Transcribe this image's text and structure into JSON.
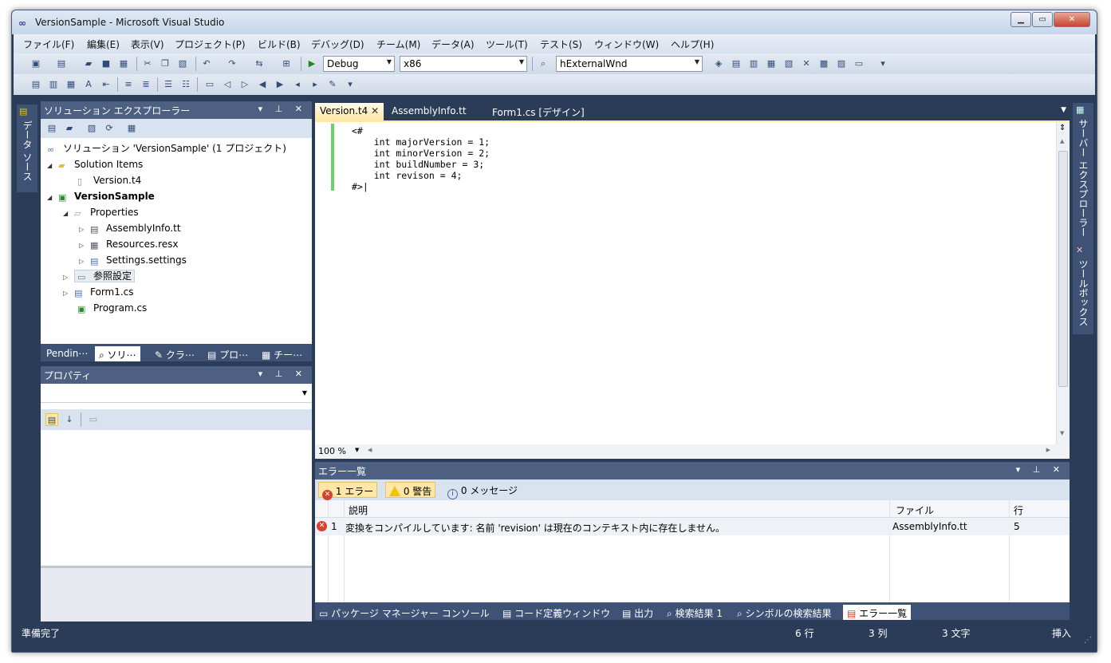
{
  "window": {
    "title": "VersionSample - Microsoft Visual Studio"
  },
  "menu": [
    "ファイル(F)",
    "編集(E)",
    "表示(V)",
    "プロジェクト(P)",
    "ビルド(B)",
    "デバッグ(D)",
    "チーム(M)",
    "データ(A)",
    "ツール(T)",
    "テスト(S)",
    "ウィンドウ(W)",
    "ヘルプ(H)"
  ],
  "toolbar": {
    "config": "Debug",
    "platform": "x86",
    "find": "hExternalWnd"
  },
  "left_side_tab": "データ ソース",
  "right_side_tabs": [
    "サーバー エクスプローラー",
    "ツールボックス"
  ],
  "solution_explorer": {
    "title": "ソリューション エクスプローラー",
    "tree": [
      {
        "label": "ソリューション 'VersionSample' (1 プロジェクト)"
      },
      {
        "label": "Solution Items"
      },
      {
        "label": "Version.t4"
      },
      {
        "label": "VersionSample"
      },
      {
        "label": "Properties"
      },
      {
        "label": "AssemblyInfo.tt"
      },
      {
        "label": "Resources.resx"
      },
      {
        "label": "Settings.settings"
      },
      {
        "label": "参照設定"
      },
      {
        "label": "Form1.cs"
      },
      {
        "label": "Program.cs"
      }
    ],
    "tabs": [
      "Pendin⋯",
      "ソリ⋯",
      "クラ⋯",
      "プロ⋯",
      "チー⋯"
    ]
  },
  "properties": {
    "title": "プロパティ"
  },
  "editor": {
    "tabs": [
      "Version.t4",
      "AssemblyInfo.tt",
      "Form1.cs [デザイン]"
    ],
    "code": "<#\n    int majorVersion = 1;\n    int minorVersion = 2;\n    int buildNumber = 3;\n    int revison = 4;\n#>|",
    "zoom": "100 %"
  },
  "error_list": {
    "title": "エラー一覧",
    "errors_btn": "1 エラー",
    "warnings_btn": "0 警告",
    "messages_btn": "0 メッセージ",
    "columns": {
      "desc": "説明",
      "file": "ファイル",
      "line": "行"
    },
    "rows": [
      {
        "num": "1",
        "desc": "変換をコンパイルしています: 名前 'revision' は現在のコンテキスト内に存在しません。",
        "file": "AssemblyInfo.tt",
        "line": "5"
      }
    ]
  },
  "bottom_tabs": [
    "パッケージ マネージャー コンソール",
    "コード定義ウィンドウ",
    "出力",
    "検索結果 1",
    "シンボルの検索結果",
    "エラー一覧"
  ],
  "status": {
    "ready": "準備完了",
    "row": "6 行",
    "col": "3 列",
    "char": "3 文字",
    "mode": "挿入"
  }
}
